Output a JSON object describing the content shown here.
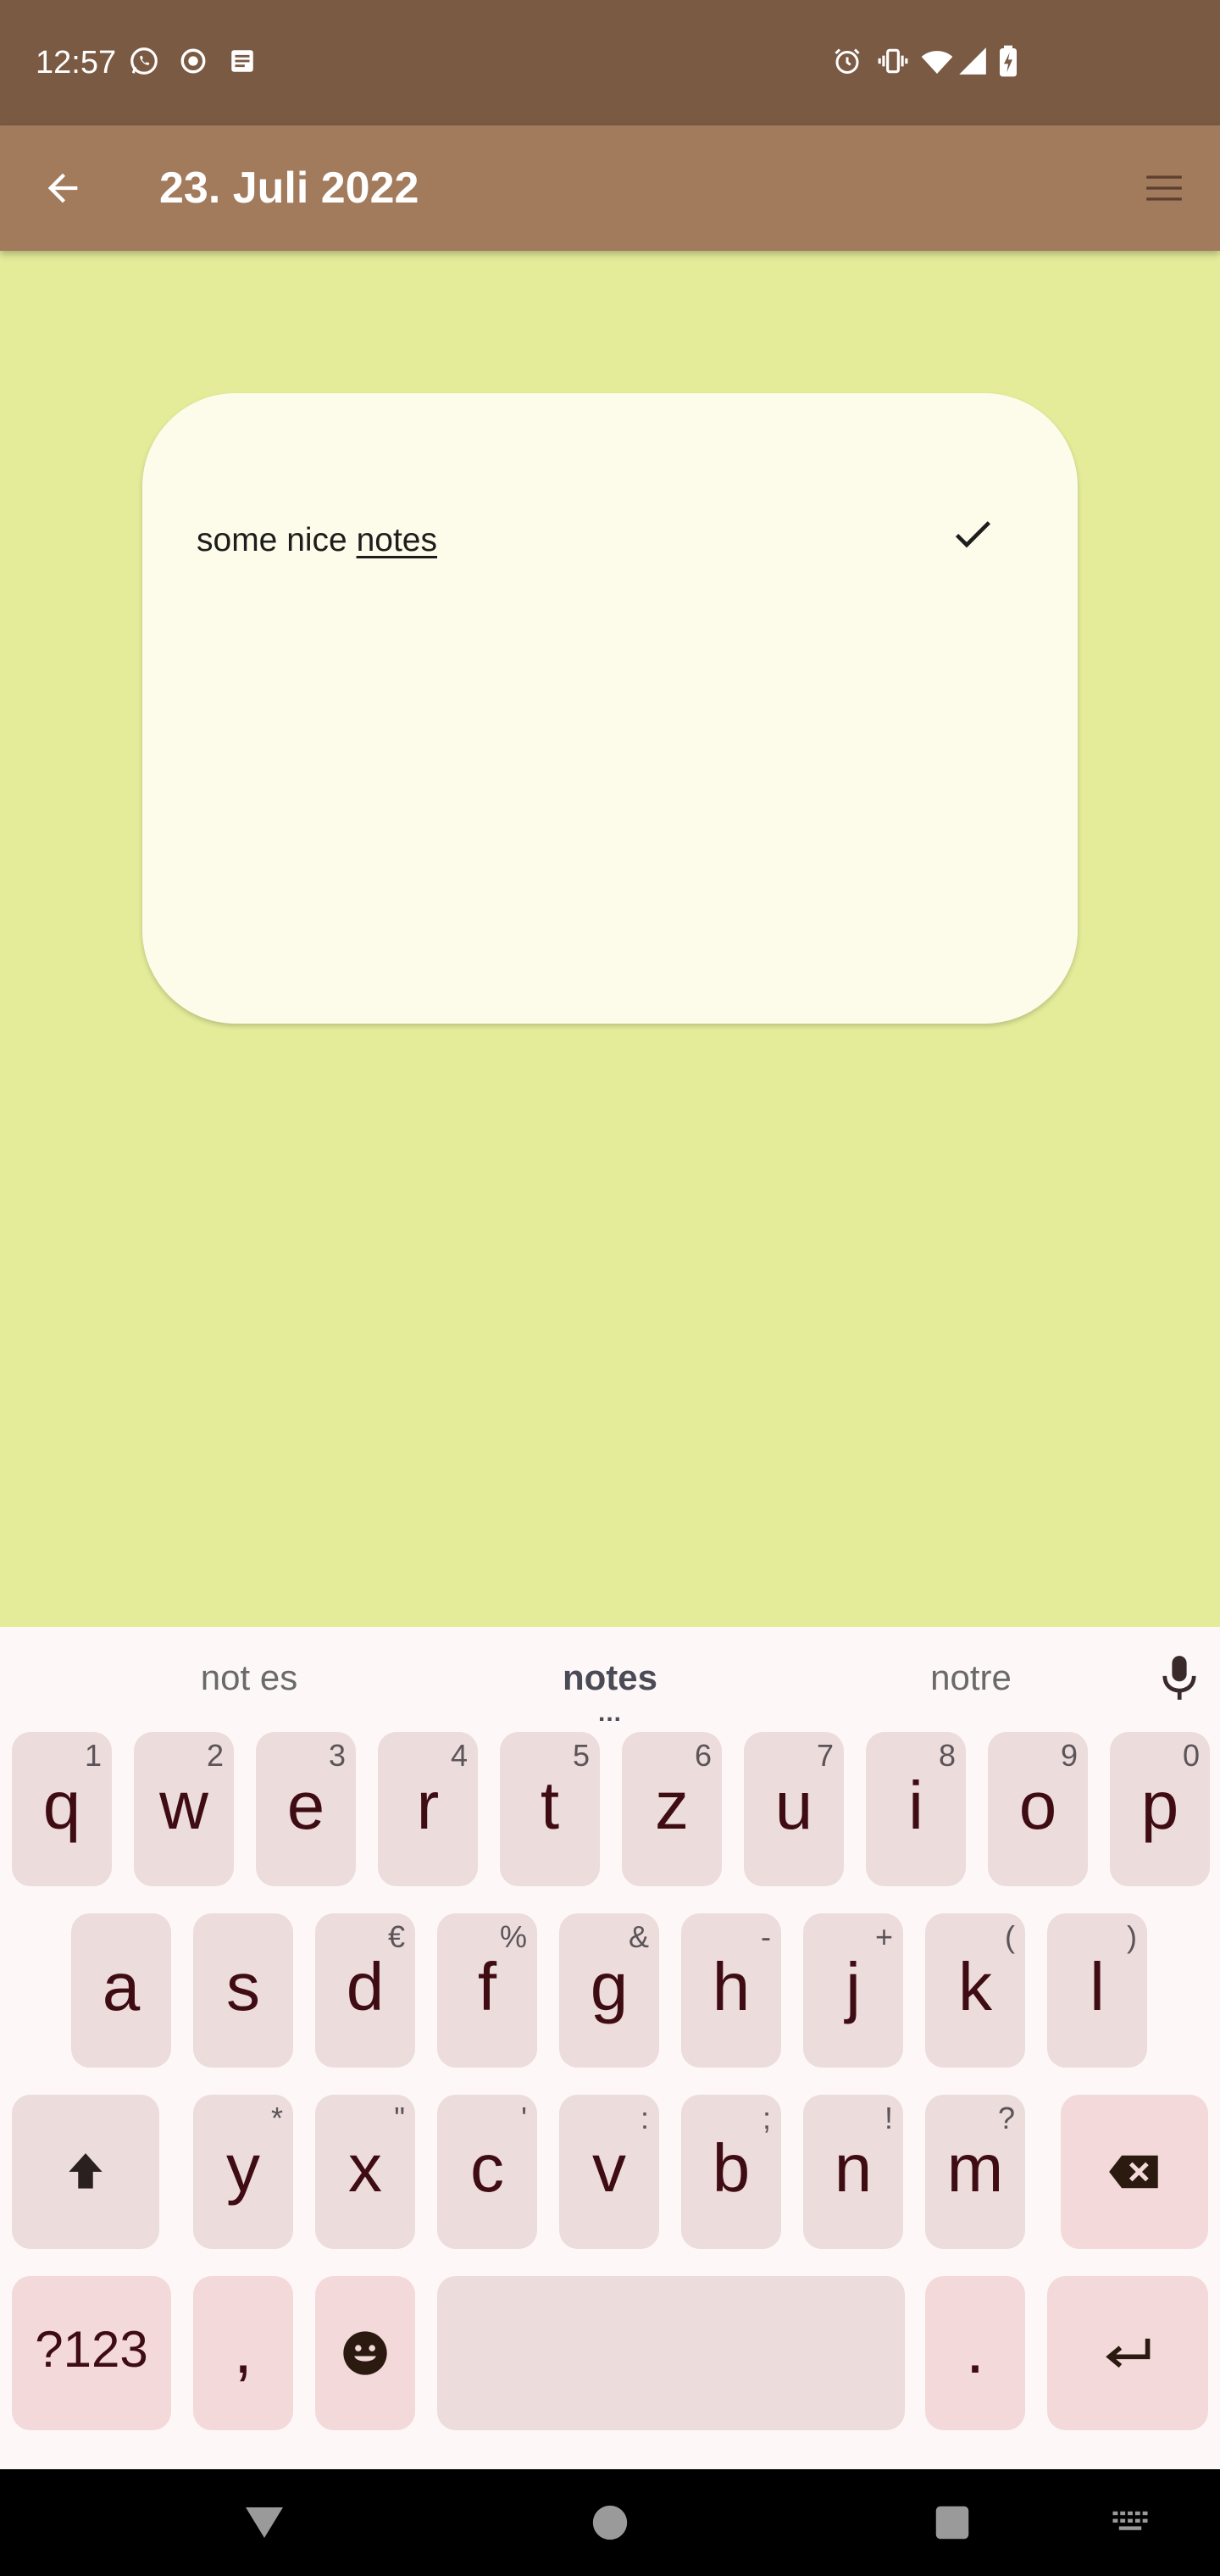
{
  "status_bar": {
    "time": "12:57",
    "left_icons": [
      "whatsapp-icon",
      "record-icon",
      "note-icon"
    ],
    "right_icons": [
      "alarm-icon",
      "vibrate-icon",
      "wifi-icon",
      "signal-icon",
      "battery-charging-icon"
    ]
  },
  "app_bar": {
    "title": "23. Juli 2022",
    "back_icon": "arrow-left-icon",
    "menu_icon": "hamburger-menu-icon"
  },
  "note": {
    "text_prefix": "some nice ",
    "text_underlined": "notes",
    "confirm_icon": "checkmark-icon"
  },
  "keyboard": {
    "suggestions": [
      "not es",
      "notes",
      "notre"
    ],
    "suggestions_more": "...",
    "row1": [
      {
        "key": "q",
        "hint": "1"
      },
      {
        "key": "w",
        "hint": "2"
      },
      {
        "key": "e",
        "hint": "3"
      },
      {
        "key": "r",
        "hint": "4"
      },
      {
        "key": "t",
        "hint": "5"
      },
      {
        "key": "z",
        "hint": "6"
      },
      {
        "key": "u",
        "hint": "7"
      },
      {
        "key": "i",
        "hint": "8"
      },
      {
        "key": "o",
        "hint": "9"
      },
      {
        "key": "p",
        "hint": "0"
      }
    ],
    "row2": [
      {
        "key": "a",
        "hint": ""
      },
      {
        "key": "s",
        "hint": ""
      },
      {
        "key": "d",
        "hint": "€"
      },
      {
        "key": "f",
        "hint": "%"
      },
      {
        "key": "g",
        "hint": "&"
      },
      {
        "key": "h",
        "hint": "-"
      },
      {
        "key": "j",
        "hint": "+"
      },
      {
        "key": "k",
        "hint": "("
      },
      {
        "key": "l",
        "hint": ")"
      }
    ],
    "row3": [
      {
        "key": "y",
        "hint": "*"
      },
      {
        "key": "x",
        "hint": "\""
      },
      {
        "key": "c",
        "hint": "'"
      },
      {
        "key": "v",
        "hint": ":"
      },
      {
        "key": "b",
        "hint": ";"
      },
      {
        "key": "n",
        "hint": "!"
      },
      {
        "key": "m",
        "hint": "?"
      }
    ],
    "symbols_label": "?123",
    "comma_label": ",",
    "period_label": ".",
    "colors": {
      "key_bg": "#ecdcdc",
      "special_bg": "#f3d9da",
      "key_text": "#3e0c12"
    }
  },
  "nav_bar": {
    "icons": [
      "back-triangle-icon",
      "home-circle-icon",
      "recents-square-icon",
      "keyboard-switch-icon"
    ]
  },
  "colors": {
    "status_bar": "#7a5a43",
    "app_bar": "#a27a5c",
    "background": "#e4ec9a",
    "card": "#fdfcea"
  }
}
